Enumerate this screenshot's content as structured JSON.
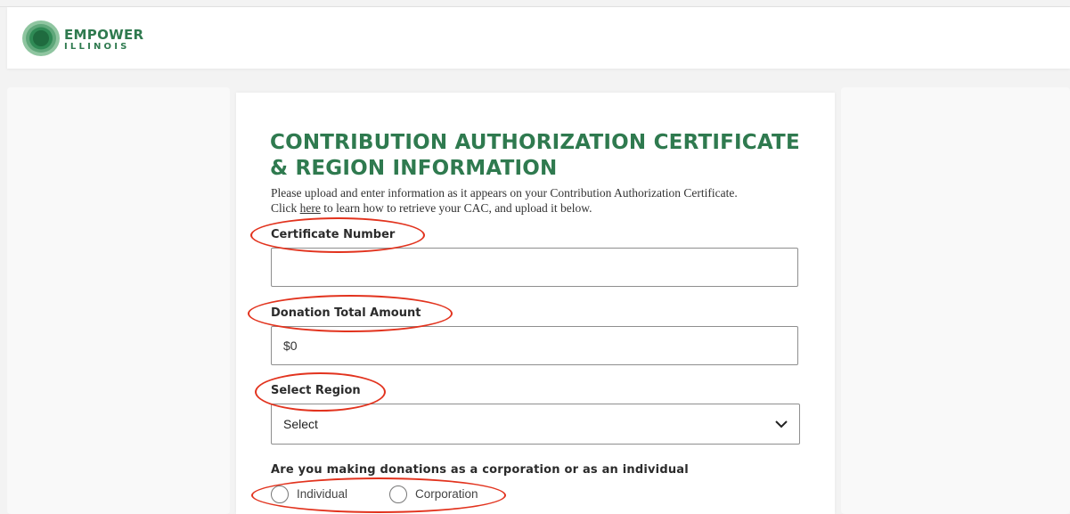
{
  "brand": {
    "name_line1": "EMPOWER",
    "name_line2": "ILLINOIS",
    "logo_icon": "empower-illinois-logo-icon",
    "primary_color": "#2f7a4f"
  },
  "form": {
    "title": "CONTRIBUTION AUTHORIZATION CERTIFICATE & REGION INFORMATION",
    "intro_line1": "Please upload and enter information as it appears on your Contribution Authorization Certificate.",
    "intro_click": "Click ",
    "intro_link": "here",
    "intro_rest": " to learn how to retrieve your CAC, and upload it below.",
    "certificate_number": {
      "label": "Certificate Number",
      "value": ""
    },
    "donation_total": {
      "label": "Donation Total Amount",
      "value": "$0"
    },
    "region": {
      "label": "Select Region",
      "selected": "Select",
      "icon": "chevron-down-icon"
    },
    "donor_type": {
      "question": "Are you making donations as a corporation or as an individual",
      "options": [
        "Individual",
        "Corporation"
      ]
    }
  },
  "annotation_color": "#e2331e"
}
